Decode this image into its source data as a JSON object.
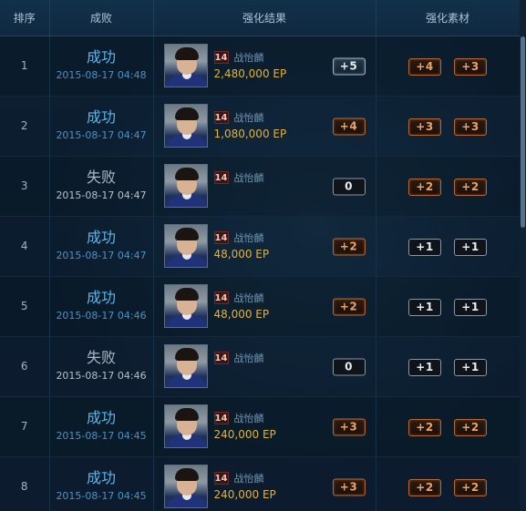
{
  "headers": {
    "rank": "排序",
    "result": "成败",
    "card": "强化结果",
    "materials": "强化素材"
  },
  "rows": [
    {
      "rank": "1",
      "result": "成功",
      "status": "success",
      "time": "2015-08-17 04:48",
      "badge": "14",
      "player": "战怡麟",
      "ep": "2,480,000 EP",
      "level": "+5",
      "level_style": "silver",
      "materials": [
        {
          "label": "+4",
          "style": "bronze"
        },
        {
          "label": "+3",
          "style": "bronze"
        }
      ]
    },
    {
      "rank": "2",
      "result": "成功",
      "status": "success",
      "time": "2015-08-17 04:47",
      "badge": "14",
      "player": "战怡麟",
      "ep": "1,080,000 EP",
      "level": "+4",
      "level_style": "bronze",
      "materials": [
        {
          "label": "+3",
          "style": "bronze"
        },
        {
          "label": "+3",
          "style": "bronze"
        }
      ]
    },
    {
      "rank": "3",
      "result": "失败",
      "status": "fail",
      "time": "2015-08-17 04:47",
      "badge": "14",
      "player": "战怡麟",
      "ep": "",
      "level": "0",
      "level_style": "dark",
      "materials": [
        {
          "label": "+2",
          "style": "bronze"
        },
        {
          "label": "+2",
          "style": "bronze"
        }
      ]
    },
    {
      "rank": "4",
      "result": "成功",
      "status": "success",
      "time": "2015-08-17 04:47",
      "badge": "14",
      "player": "战怡麟",
      "ep": "48,000 EP",
      "level": "+2",
      "level_style": "bronze",
      "materials": [
        {
          "label": "+1",
          "style": "dark"
        },
        {
          "label": "+1",
          "style": "dark"
        }
      ]
    },
    {
      "rank": "5",
      "result": "成功",
      "status": "success",
      "time": "2015-08-17 04:46",
      "badge": "14",
      "player": "战怡麟",
      "ep": "48,000 EP",
      "level": "+2",
      "level_style": "bronze",
      "materials": [
        {
          "label": "+1",
          "style": "dark"
        },
        {
          "label": "+1",
          "style": "dark"
        }
      ]
    },
    {
      "rank": "6",
      "result": "失败",
      "status": "fail",
      "time": "2015-08-17 04:46",
      "badge": "14",
      "player": "战怡麟",
      "ep": "",
      "level": "0",
      "level_style": "dark",
      "materials": [
        {
          "label": "+1",
          "style": "dark"
        },
        {
          "label": "+1",
          "style": "dark"
        }
      ]
    },
    {
      "rank": "7",
      "result": "成功",
      "status": "success",
      "time": "2015-08-17 04:45",
      "badge": "14",
      "player": "战怡麟",
      "ep": "240,000 EP",
      "level": "+3",
      "level_style": "bronze",
      "materials": [
        {
          "label": "+2",
          "style": "bronze"
        },
        {
          "label": "+2",
          "style": "bronze"
        }
      ]
    },
    {
      "rank": "8",
      "result": "成功",
      "status": "success",
      "time": "2015-08-17 04:45",
      "badge": "14",
      "player": "战怡麟",
      "ep": "240,000 EP",
      "level": "+3",
      "level_style": "bronze",
      "materials": [
        {
          "label": "+2",
          "style": "bronze"
        },
        {
          "label": "+2",
          "style": "bronze"
        }
      ]
    }
  ],
  "colors": {
    "success": "#5fb5ea",
    "fail": "#aab8c4",
    "ep": "#e2b23c",
    "bronze": "#b3683a",
    "silver": "#9ab2c2"
  },
  "icons": {
    "avatar": "player-portrait-icon",
    "badge": "season-badge-icon"
  }
}
